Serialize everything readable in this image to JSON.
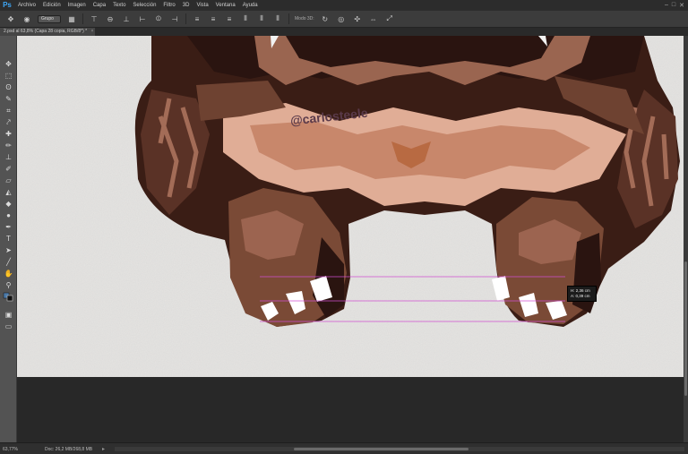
{
  "app": {
    "logo": "Ps"
  },
  "menu": [
    "Archivo",
    "Edición",
    "Imagen",
    "Capa",
    "Texto",
    "Selección",
    "Filtro",
    "3D",
    "Vista",
    "Ventana",
    "Ayuda"
  ],
  "window_controls": [
    "–",
    "□",
    "✕"
  ],
  "options": {
    "auto_select_value": "Grupo",
    "mode_3d_label": "Modo 3D:"
  },
  "document": {
    "tab_title": "2.psd al 63,8% (Capa 28 copia, RGB/8*) *",
    "tab_close": "×"
  },
  "canvas": {
    "watermark": "@carlosteele",
    "guide_color": "#d14fd1"
  },
  "measure": {
    "width": "H: 2,36 cm",
    "height": "A: 0,39 cm"
  },
  "status": {
    "zoom": "63,77%",
    "doc_size": "Doc: 26,2 MB/268,8 MB",
    "arrow": "▸"
  },
  "tools": [
    "move-tool",
    "marquee-tool",
    "lasso-tool",
    "quick-select-tool",
    "crop-tool",
    "eyedropper-tool",
    "healing-brush-tool",
    "brush-tool",
    "clone-stamp-tool",
    "history-brush-tool",
    "eraser-tool",
    "gradient-tool",
    "blur-tool",
    "dodge-tool",
    "pen-tool",
    "type-tool",
    "path-select-tool",
    "shape-tool",
    "hand-tool",
    "zoom-tool",
    "color-swatches",
    "quick-mask",
    "screen-mode"
  ],
  "colors": {
    "accent": "#3ea6f5",
    "fur_dark": "#2a140f",
    "fur_mid": "#6b3e2e",
    "fur_light": "#c58a6c",
    "fur_pale": "#e1b09a"
  }
}
